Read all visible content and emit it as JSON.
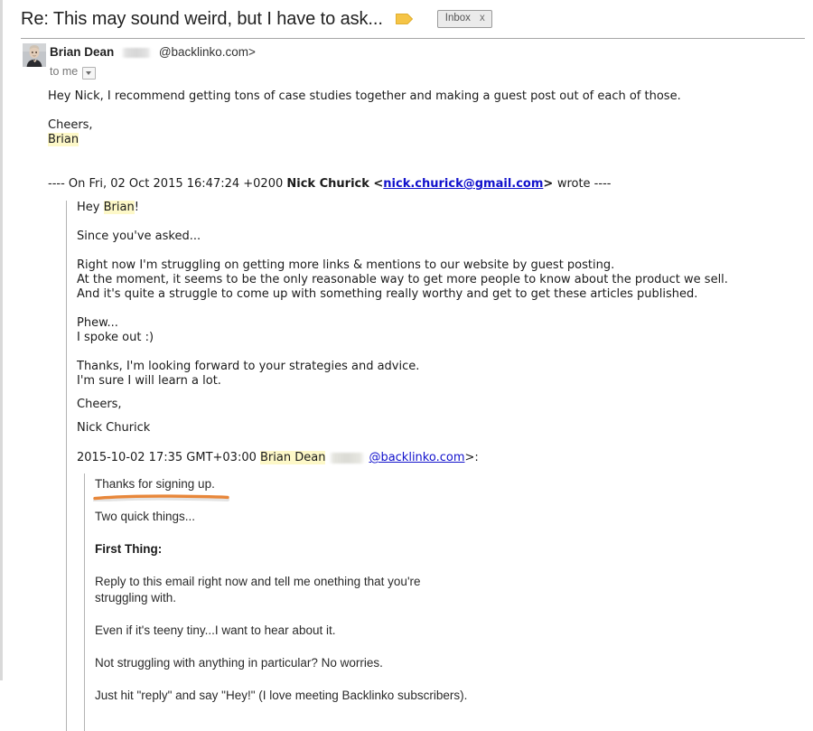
{
  "window": {
    "title": "Re: This may sound weird, but I have to ask..."
  },
  "header": {
    "subject": "Re: This may sound weird, but I have to ask...",
    "label_icon": "label-tag-icon",
    "chip_label": "Inbox",
    "chip_close": "x"
  },
  "sender": {
    "avatar_icon": "user-avatar-photo",
    "name": "Brian Dean",
    "address_suffix": "@backlinko.com>",
    "recipient": "to me",
    "details_caret_icon": "chevron-down-icon"
  },
  "reply": {
    "paragraph_1": "Hey Nick, I recommend getting tons of case studies together and making a guest post out of each of those.",
    "signoff": "Cheers,",
    "signature_name": "Brian"
  },
  "quote_header": {
    "prefix": "---- On Fri, 02 Oct 2015 16:47:24 +0200 ",
    "author": "Nick Churick",
    "open_bracket": " <",
    "email": "nick.churick@gmail.com",
    "close_bracket": "> ",
    "suffix": "wrote ----"
  },
  "quoted_message": {
    "greeting_pre": "Hey ",
    "greeting_name": "Brian",
    "greeting_post": "!",
    "line_since": "Since you've asked...",
    "para_struggle_1": "Right now I'm struggling on getting more links & mentions to our website by guest posting.",
    "para_struggle_2": "At the moment, it seems to be the only reasonable way to get more people to know about the product we sell.",
    "para_struggle_3": "And it's quite a struggle to come up with something really worthy and get to get these articles published.",
    "phew": "Phew...",
    "spoke_out": "I spoke out :)",
    "thanks_1": "Thanks, I'm looking forward to your strategies and advice.",
    "thanks_2": "I'm sure I will learn a lot.",
    "cheers": "Cheers,",
    "signature": "Nick Churick"
  },
  "quote_header_2": {
    "datetime": "2015-10-02 17:35 GMT+03:00 ",
    "author": "Brian Dean",
    "email": "@backlinko.com",
    "tail": ">:"
  },
  "welcome_message": {
    "thanks_line": "Thanks for signing up.",
    "two_things": "Two quick things...",
    "first_thing_heading": "First Thing:",
    "reply_prompt": "Reply to this email right now and tell me onething that you're struggling with.",
    "teeny_tiny": "Even if it's teeny tiny...I want to hear about it.",
    "no_worries": "Not struggling with anything in particular? No worries.",
    "just_hit_reply": "Just hit \"reply\" and say \"Hey!\" (I love meeting Backlinko subscribers)."
  },
  "annotation": {
    "underline_icon": "orange-underline-annotation",
    "color": "#e8873a"
  },
  "colors": {
    "highlight": "#fdf8c8",
    "link": "#1111cc",
    "label_tag": "#f5c446",
    "annotation_orange": "#e8873a",
    "quote_bar": "#b3b3b3"
  }
}
